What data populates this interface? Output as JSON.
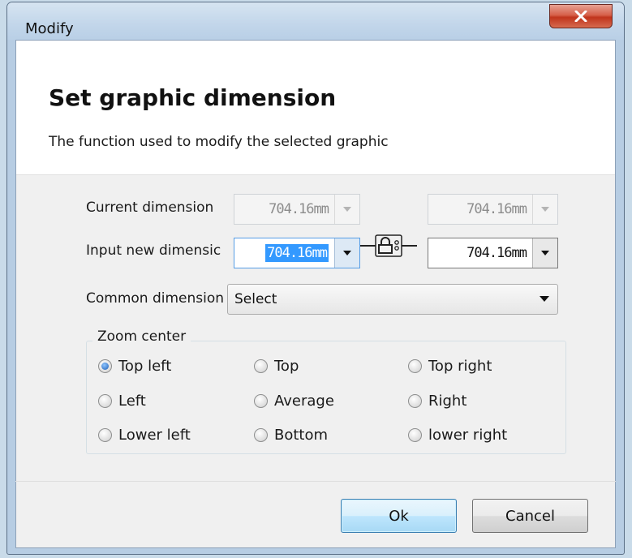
{
  "window": {
    "title": "Modify",
    "close_glyph": "x"
  },
  "header": {
    "heading": "Set graphic dimension",
    "description": "The function used to modify the selected graphic"
  },
  "form": {
    "current_dimension_label": "Current dimension",
    "current_width": "704.16mm",
    "current_height": "704.16mm",
    "input_new_dimension_label": "Input new dimensic",
    "new_width": "704.16mm",
    "new_height": "704.16mm",
    "lock_icon": "lock-icon",
    "common_dimension_label": "Common dimension",
    "common_dimension_value": "Select"
  },
  "zoom_center": {
    "legend": "Zoom center",
    "options": [
      {
        "label": "Top left",
        "checked": true
      },
      {
        "label": "Top",
        "checked": false
      },
      {
        "label": "Top right",
        "checked": false
      },
      {
        "label": "Left",
        "checked": false
      },
      {
        "label": "Average",
        "checked": false
      },
      {
        "label": "Right",
        "checked": false
      },
      {
        "label": "Lower left",
        "checked": false
      },
      {
        "label": "Bottom",
        "checked": false
      },
      {
        "label": "lower right",
        "checked": false
      }
    ]
  },
  "buttons": {
    "ok": "Ok",
    "cancel": "Cancel"
  },
  "colors": {
    "selection": "#3399ff",
    "close_button": "#c7432b",
    "dialog_bg": "#f0f0f0"
  }
}
